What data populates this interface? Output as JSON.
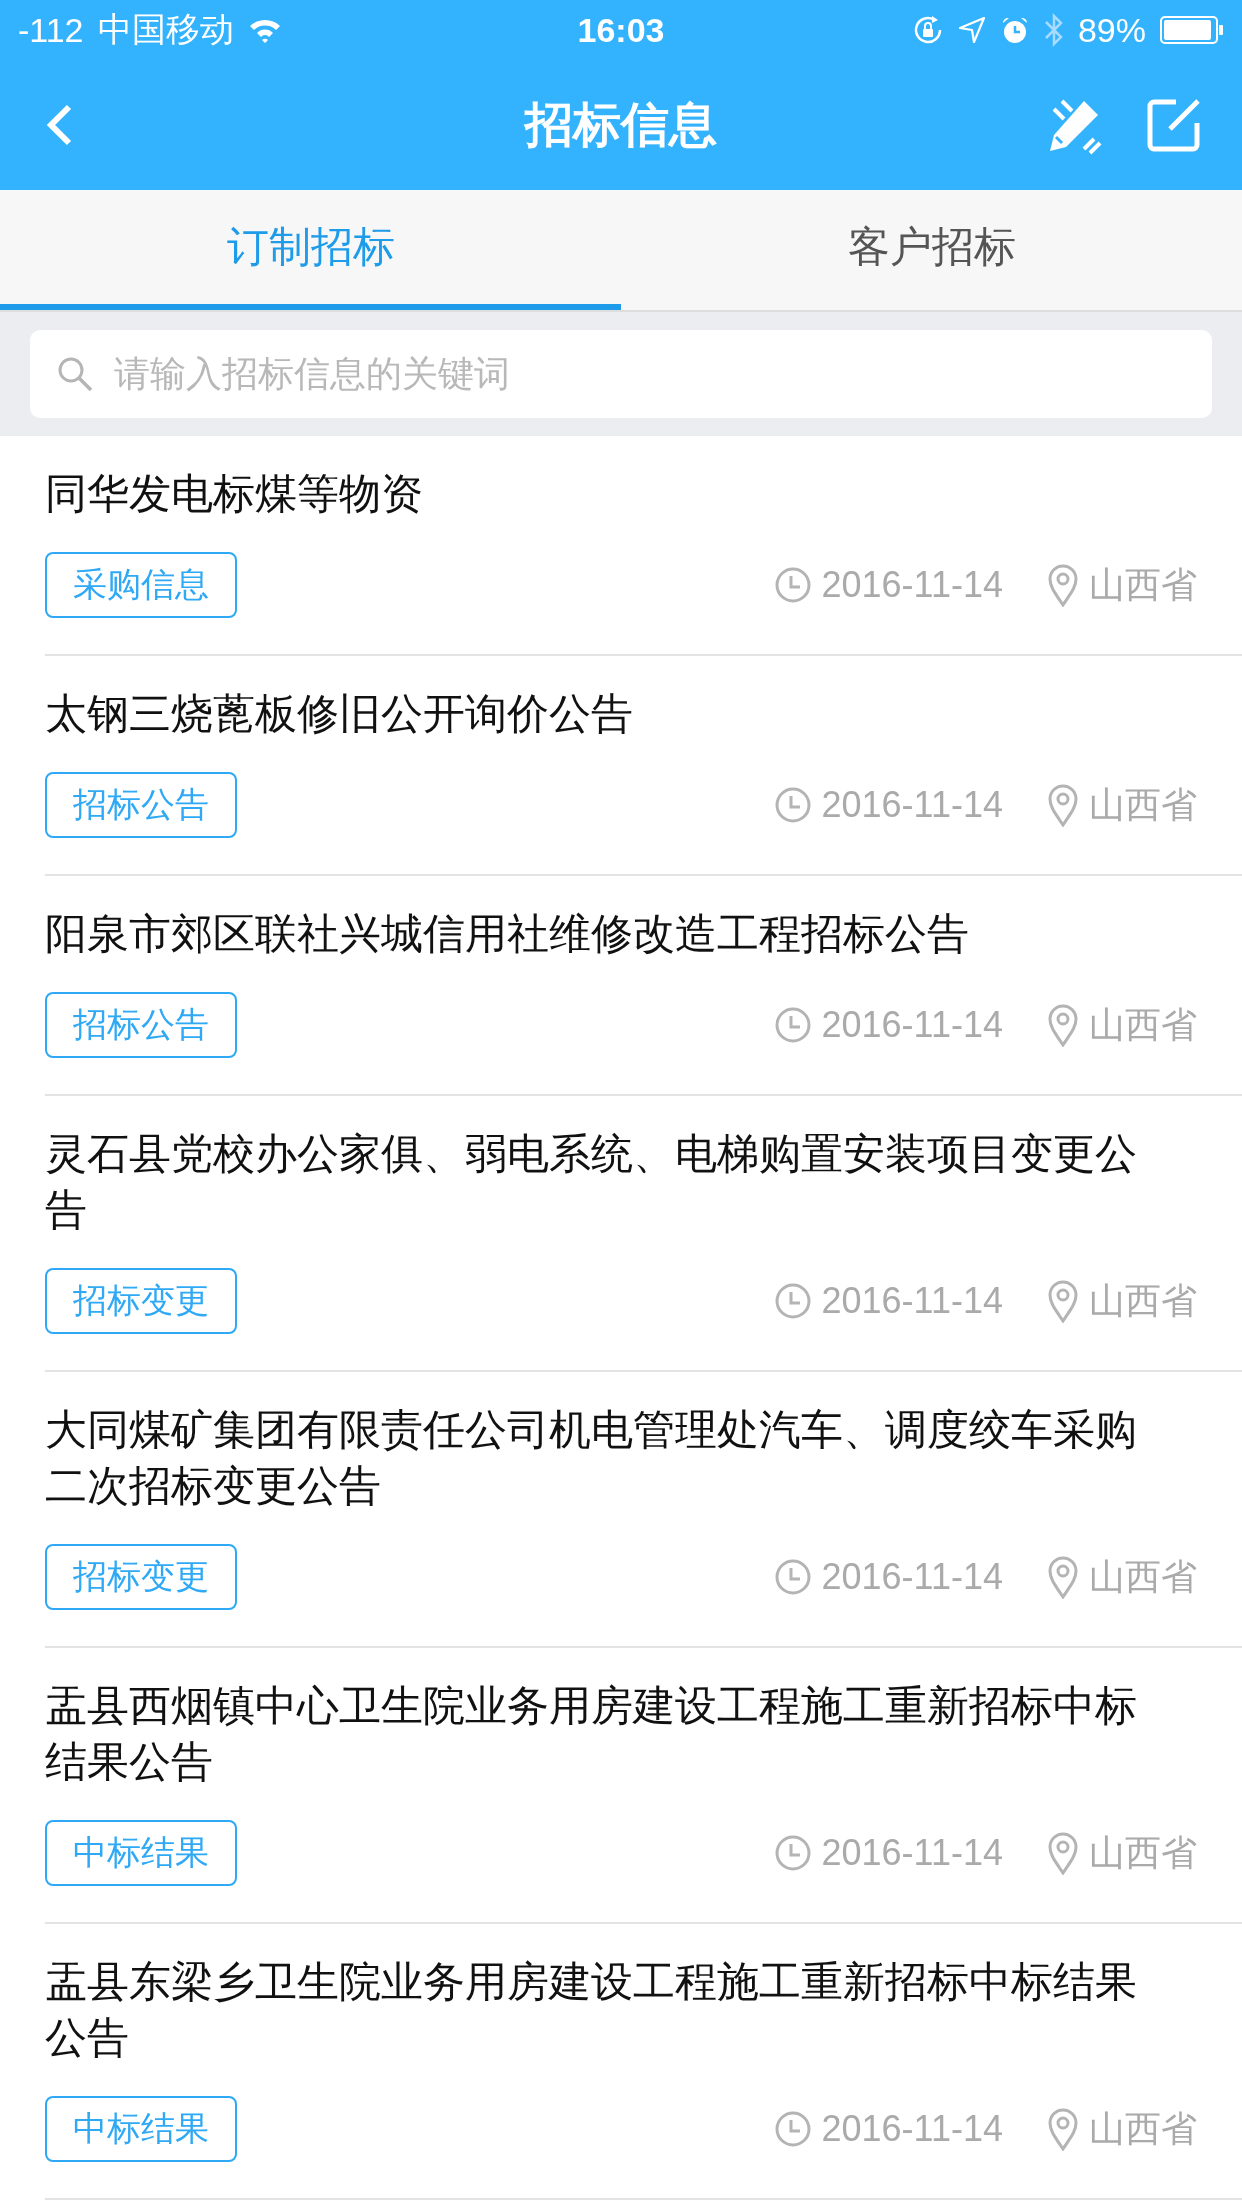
{
  "status_bar": {
    "signal": "-112",
    "carrier": "中国移动",
    "time": "16:03",
    "battery": "89%"
  },
  "header": {
    "title": "招标信息"
  },
  "tabs": [
    {
      "label": "订制招标",
      "selected": true
    },
    {
      "label": "客户招标",
      "selected": false
    }
  ],
  "search": {
    "placeholder": "请输入招标信息的关键词"
  },
  "items": [
    {
      "title": "同华发电标煤等物资",
      "tag": "采购信息",
      "date": "2016-11-14",
      "region": "山西省"
    },
    {
      "title": "太钢三烧蓖板修旧公开询价公告",
      "tag": "招标公告",
      "date": "2016-11-14",
      "region": "山西省"
    },
    {
      "title": "阳泉市郊区联社兴城信用社维修改造工程招标公告",
      "tag": "招标公告",
      "date": "2016-11-14",
      "region": "山西省"
    },
    {
      "title": "灵石县党校办公家俱、弱电系统、电梯购置安装项目变更公告",
      "tag": "招标变更",
      "date": "2016-11-14",
      "region": "山西省"
    },
    {
      "title": "大同煤矿集团有限责任公司机电管理处汽车、调度绞车采购二次招标变更公告",
      "tag": "招标变更",
      "date": "2016-11-14",
      "region": "山西省"
    },
    {
      "title": "盂县西烟镇中心卫生院业务用房建设工程施工重新招标中标结果公告",
      "tag": "中标结果",
      "date": "2016-11-14",
      "region": "山西省"
    },
    {
      "title": "盂县东梁乡卫生院业务用房建设工程施工重新招标中标结果公告",
      "tag": "中标结果",
      "date": "2016-11-14",
      "region": "山西省"
    }
  ]
}
